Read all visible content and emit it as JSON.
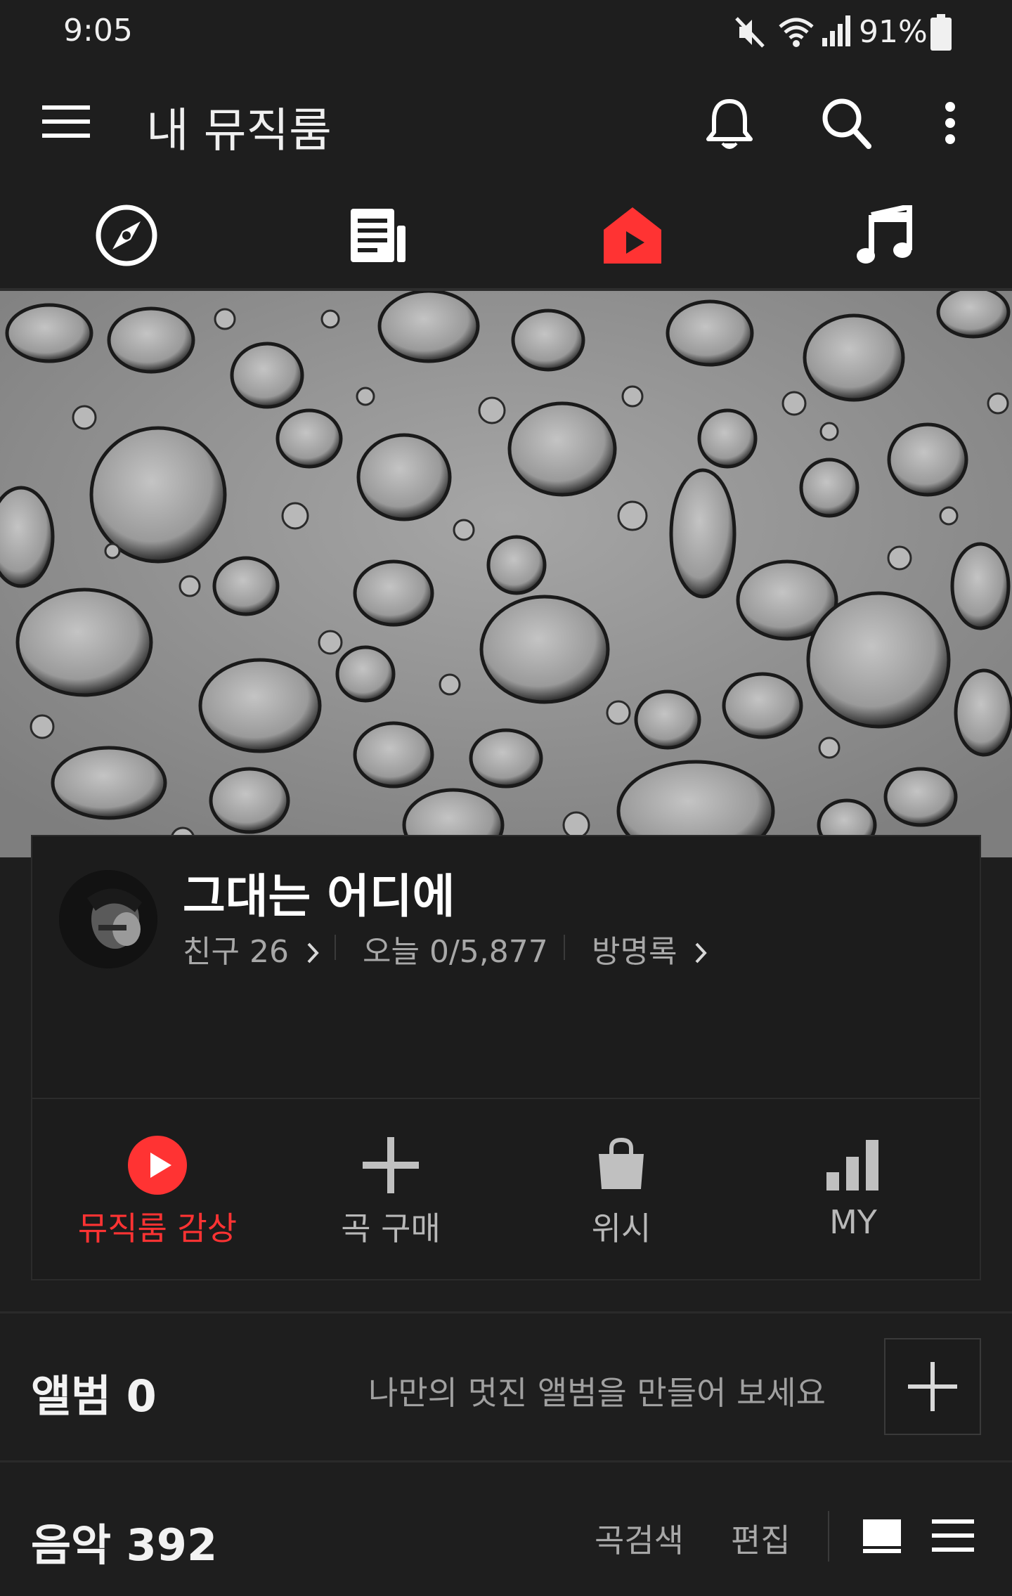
{
  "status_bar": {
    "time": "9:05",
    "battery": "91%",
    "icons": [
      "mute-icon",
      "wifi-icon",
      "signal-icon",
      "battery-icon"
    ]
  },
  "header": {
    "title": "내 뮤직룸",
    "icons": [
      "menu-icon",
      "bell-icon",
      "search-icon",
      "more-vert-icon"
    ]
  },
  "tabs": [
    {
      "name": "compass-icon",
      "active": false
    },
    {
      "name": "news-icon",
      "active": false
    },
    {
      "name": "music-room-icon",
      "active": true
    },
    {
      "name": "music-note-icon",
      "active": false
    }
  ],
  "profile": {
    "nickname": "그대는 어디에",
    "friends": "친구 26",
    "today": "오늘 0/5,877",
    "guestbook": "방명록"
  },
  "actions": [
    {
      "label": "뮤직룸 감상",
      "icon": "play-circle-icon"
    },
    {
      "label": "곡 구매",
      "icon": "plus-icon"
    },
    {
      "label": "위시",
      "icon": "shopping-bag-icon"
    },
    {
      "label": "MY",
      "icon": "bar-chart-icon"
    }
  ],
  "album": {
    "title": "앨범 0",
    "hint": "나만의 멋진 앨범을 만들어 보세요"
  },
  "music": {
    "title": "음악 392",
    "search": "곡검색",
    "edit": "편집"
  },
  "colors": {
    "background": "#1e1e1e",
    "accent": "#ff3333",
    "text_secondary": "#a8a8a8"
  }
}
